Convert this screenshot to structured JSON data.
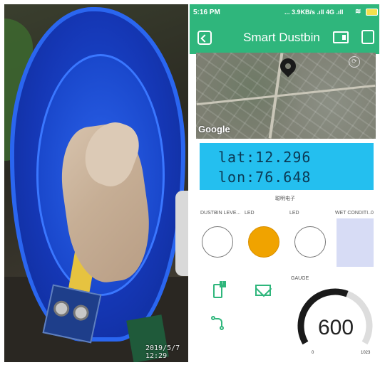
{
  "photo": {
    "timestamp": "2019/5/7 12:29"
  },
  "status_bar": {
    "time": "5:16 PM",
    "network": "... 3.9KB/s .ıll 4G .ıll",
    "wifi": "≋",
    "battery_color": "#f4e04d"
  },
  "app_bar": {
    "title": "Smart Dustbin",
    "left_icon": "back-to-projects-icon",
    "device_icon": "device-icon",
    "square_icon": "stop-icon",
    "color": "#2fb67c"
  },
  "map": {
    "attribution": "Google",
    "compass": "⟳"
  },
  "lcd": {
    "line1": "lat:12.296",
    "line2": "lon:76.648",
    "caption": "聪明电子",
    "color": "#24bfef"
  },
  "widgets": {
    "level_label": "DUSTBIN LEVE...",
    "led1_label": "LED",
    "led1_color": "#f0a300",
    "led2_label": "LED",
    "wet_label": "WET CONDITI...",
    "wet_value": "0",
    "wet_color": "#d7dcf5"
  },
  "icons": {
    "phone_badge": "!",
    "phone": "phone-notification-icon",
    "mail": "mail-icon",
    "flow": "eventor-icon"
  },
  "gauge": {
    "label": "GAUGE",
    "value": "600",
    "min": "0",
    "max": "1023",
    "fraction": 0.5865,
    "track_color": "#dddddd",
    "fill_color": "#1a1a1a"
  }
}
